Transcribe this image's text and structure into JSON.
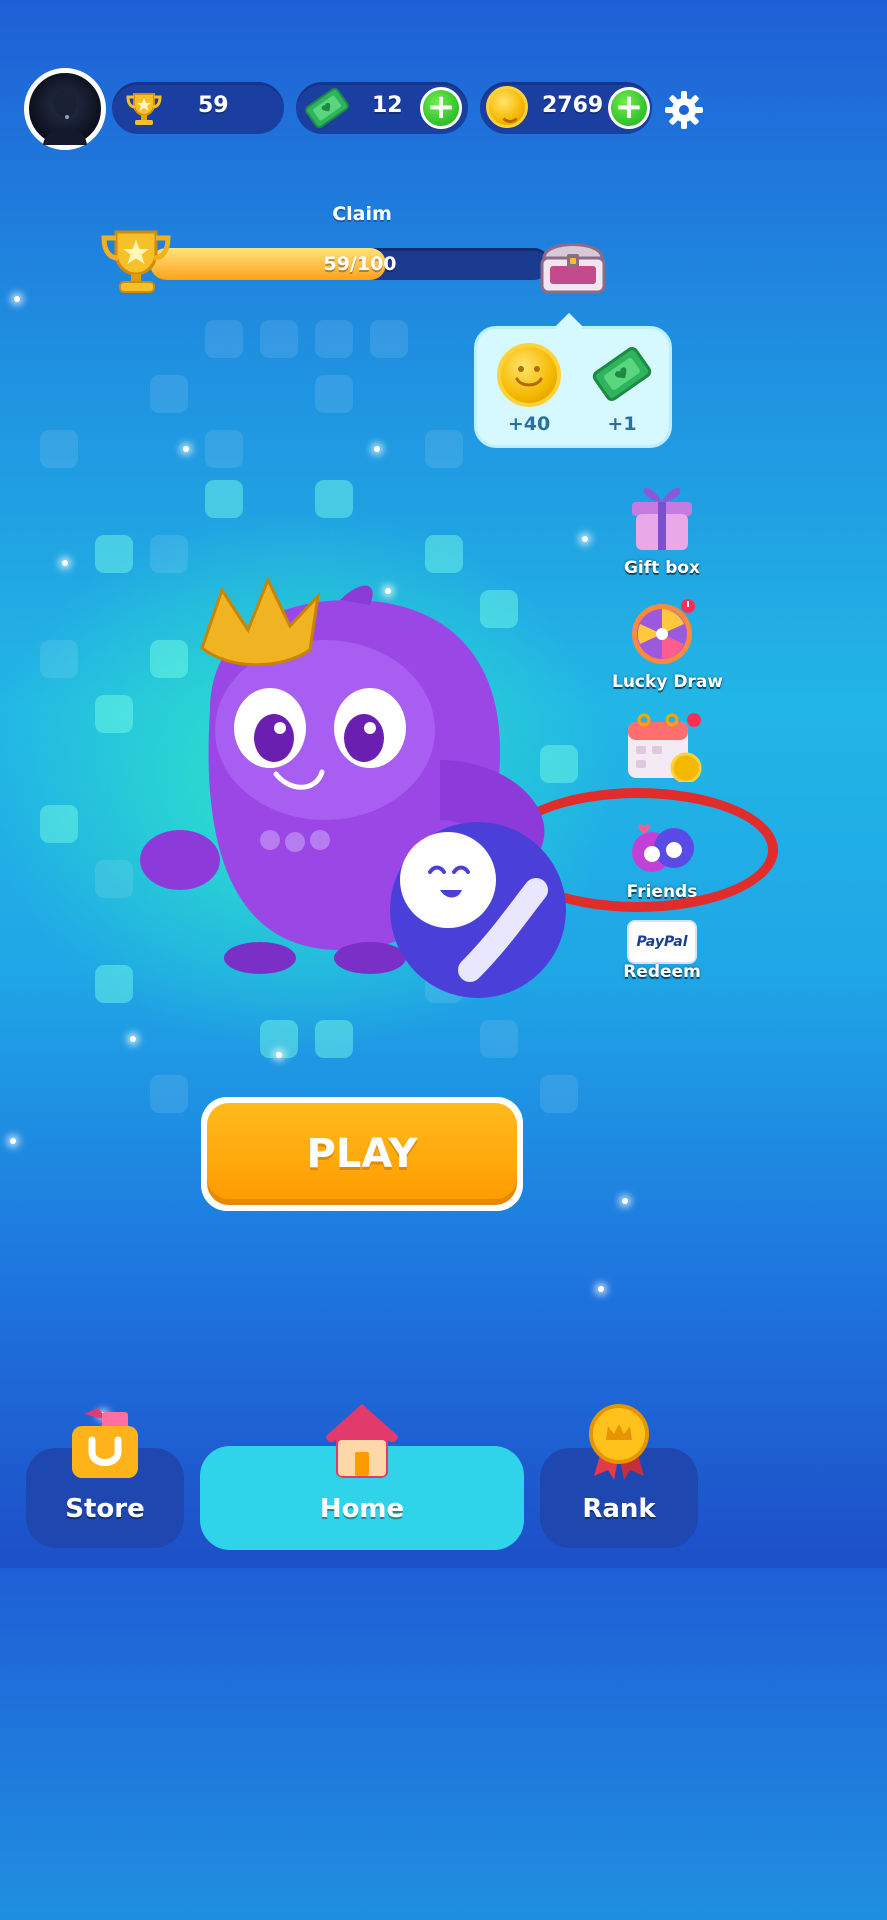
{
  "colors": {
    "accent_orange": "#ff9b00",
    "progress_fill": "#ffa21c",
    "plus_green": "#2fc02a",
    "highlight_ring": "#e12c2c"
  },
  "top_bar": {
    "trophies": "59",
    "tickets": "12",
    "coins": "2769",
    "icons": [
      "avatar",
      "trophy-icon",
      "ticket-icon",
      "coin-icon",
      "plus-icon",
      "gear-icon"
    ]
  },
  "progress": {
    "claim_label": "Claim",
    "text": "59/100",
    "fraction": 0.59
  },
  "reward_preview": {
    "coin_amount": "+40",
    "ticket_amount": "+1"
  },
  "side_menu": {
    "gift_box": "Gift box",
    "lucky_draw": "Lucky Draw",
    "friends": "Friends",
    "redeem": "Redeem",
    "paypal_logo": "PayPal"
  },
  "main": {
    "play_label": "PLAY"
  },
  "bottom_nav": {
    "store": "Store",
    "home": "Home",
    "rank": "Rank"
  }
}
